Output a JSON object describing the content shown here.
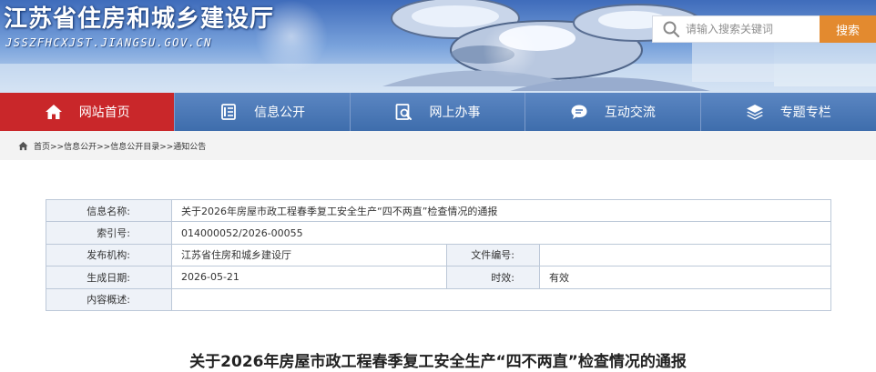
{
  "header": {
    "site_title": "江苏省住房和城乡建设厅",
    "site_url": "JSSZFHCXJST.JIANGSU.GOV.CN",
    "search_placeholder": "请输入搜索关键词",
    "search_button": "搜索"
  },
  "nav": {
    "items": [
      {
        "label": "网站首页",
        "icon": "home-icon",
        "active": true
      },
      {
        "label": "信息公开",
        "icon": "document-list-icon",
        "active": false
      },
      {
        "label": "网上办事",
        "icon": "search-doc-icon",
        "active": false
      },
      {
        "label": "互动交流",
        "icon": "chat-bubble-icon",
        "active": false
      },
      {
        "label": "专题专栏",
        "icon": "layers-icon",
        "active": false
      }
    ]
  },
  "breadcrumb": [
    "首页>>",
    "信息公开>>",
    "信息公开目录>>",
    "通知公告"
  ],
  "info": {
    "name_label": "信息名称:",
    "name_value": "关于2026年房屋市政工程春季复工安全生产“四不两直”检查情况的通报",
    "index_label": "索引号:",
    "index_value": "014000052/2026-00055",
    "org_label": "发布机构:",
    "org_value": "江苏省住房和城乡建设厅",
    "docno_label": "文件编号:",
    "docno_value": "",
    "date_label": "生成日期:",
    "date_value": "2026-05-21",
    "validity_label": "时效:",
    "validity_value": "有效",
    "summary_label": "内容概述:",
    "summary_value": ""
  },
  "article": {
    "title": "关于2026年房屋市政工程春季复工安全生产“四不两直”检查情况的通报"
  },
  "colors": {
    "nav_active": "#c9272a",
    "nav_bg": "#3e6dac",
    "search_button": "#e38a2f"
  }
}
